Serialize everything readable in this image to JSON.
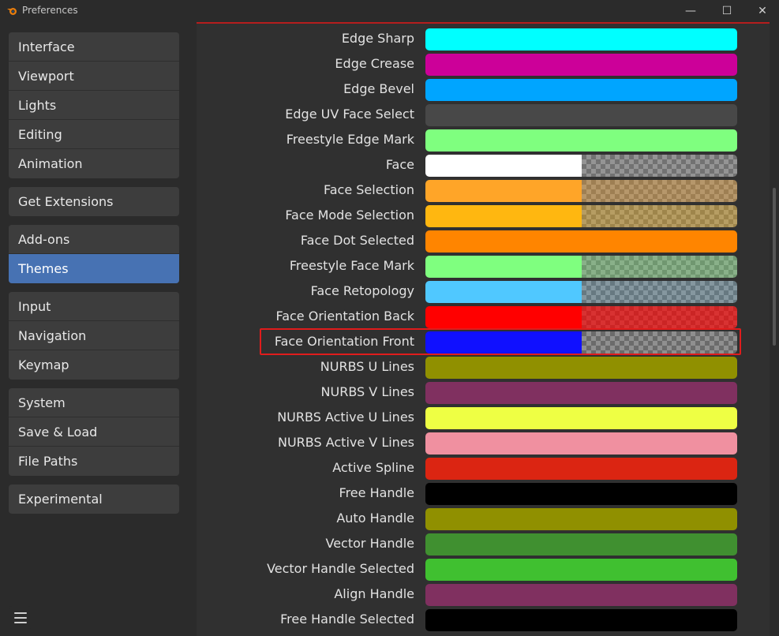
{
  "window": {
    "title": "Preferences",
    "minimize_symbol": "—",
    "maximize_symbol": "☐",
    "close_symbol": "✕"
  },
  "sidebar": {
    "groups": [
      {
        "items": [
          {
            "label": "Interface",
            "active": false
          },
          {
            "label": "Viewport",
            "active": false
          },
          {
            "label": "Lights",
            "active": false
          },
          {
            "label": "Editing",
            "active": false
          },
          {
            "label": "Animation",
            "active": false
          }
        ]
      },
      {
        "items": [
          {
            "label": "Get Extensions",
            "active": false
          }
        ]
      },
      {
        "items": [
          {
            "label": "Add-ons",
            "active": false
          },
          {
            "label": "Themes",
            "active": true
          }
        ]
      },
      {
        "items": [
          {
            "label": "Input",
            "active": false
          },
          {
            "label": "Navigation",
            "active": false
          },
          {
            "label": "Keymap",
            "active": false
          }
        ]
      },
      {
        "items": [
          {
            "label": "System",
            "active": false
          },
          {
            "label": "Save & Load",
            "active": false
          },
          {
            "label": "File Paths",
            "active": false
          }
        ]
      },
      {
        "items": [
          {
            "label": "Experimental",
            "active": false
          }
        ]
      }
    ],
    "menu_icon": "hamburger-menu-icon"
  },
  "theme_colors": [
    {
      "label": "Edge Sharp",
      "color": "#00ffff",
      "alpha": false
    },
    {
      "label": "Edge Crease",
      "color": "#cc0099",
      "alpha": false
    },
    {
      "label": "Edge Bevel",
      "color": "#00a5ff",
      "alpha": false
    },
    {
      "label": "Edge UV Face Select",
      "color": "#484848",
      "alpha": false
    },
    {
      "label": "Freestyle Edge Mark",
      "color": "#7fff7f",
      "alpha": false
    },
    {
      "label": "Face",
      "color": "#ffffff",
      "alpha": true,
      "tint": "rgba(255,255,255,0.05)"
    },
    {
      "label": "Face Selection",
      "color": "#ffa528",
      "alpha": true,
      "tint": "rgba(255,165,40,0.35)"
    },
    {
      "label": "Face Mode Selection",
      "color": "#ffb710",
      "alpha": true,
      "tint": "rgba(255,183,16,0.35)"
    },
    {
      "label": "Face Dot Selected",
      "color": "#ff8500",
      "alpha": false
    },
    {
      "label": "Freestyle Face Mark",
      "color": "#7fff7f",
      "alpha": true,
      "tint": "rgba(127,255,127,0.3)"
    },
    {
      "label": "Face Retopology",
      "color": "#50c8ff",
      "alpha": true,
      "tint": "rgba(80,200,255,0.15)"
    },
    {
      "label": "Face Orientation Back",
      "color": "#ff0000",
      "alpha": true,
      "tint": "rgba(255,0,0,0.65)"
    },
    {
      "label": "Face Orientation Front",
      "color": "#1010ff",
      "alpha": true,
      "tint": "rgba(0,0,0,0)"
    },
    {
      "label": "NURBS U Lines",
      "color": "#909000",
      "alpha": false
    },
    {
      "label": "NURBS V Lines",
      "color": "#803060",
      "alpha": false
    },
    {
      "label": "NURBS Active U Lines",
      "color": "#eeff44",
      "alpha": false
    },
    {
      "label": "NURBS Active V Lines",
      "color": "#f090a0",
      "alpha": false
    },
    {
      "label": "Active Spline",
      "color": "#db2512",
      "alpha": false
    },
    {
      "label": "Free Handle",
      "color": "#000000",
      "alpha": false
    },
    {
      "label": "Auto Handle",
      "color": "#909000",
      "alpha": false
    },
    {
      "label": "Vector Handle",
      "color": "#409030",
      "alpha": false
    },
    {
      "label": "Vector Handle Selected",
      "color": "#40c030",
      "alpha": false
    },
    {
      "label": "Align Handle",
      "color": "#803060",
      "alpha": false
    },
    {
      "label": "Free Handle Selected",
      "color": "#000000",
      "alpha": false
    }
  ],
  "highlighted_row": "Face Orientation Front",
  "colors": {
    "accent": "#4772b3",
    "highlight_border": "#e01c1c"
  }
}
